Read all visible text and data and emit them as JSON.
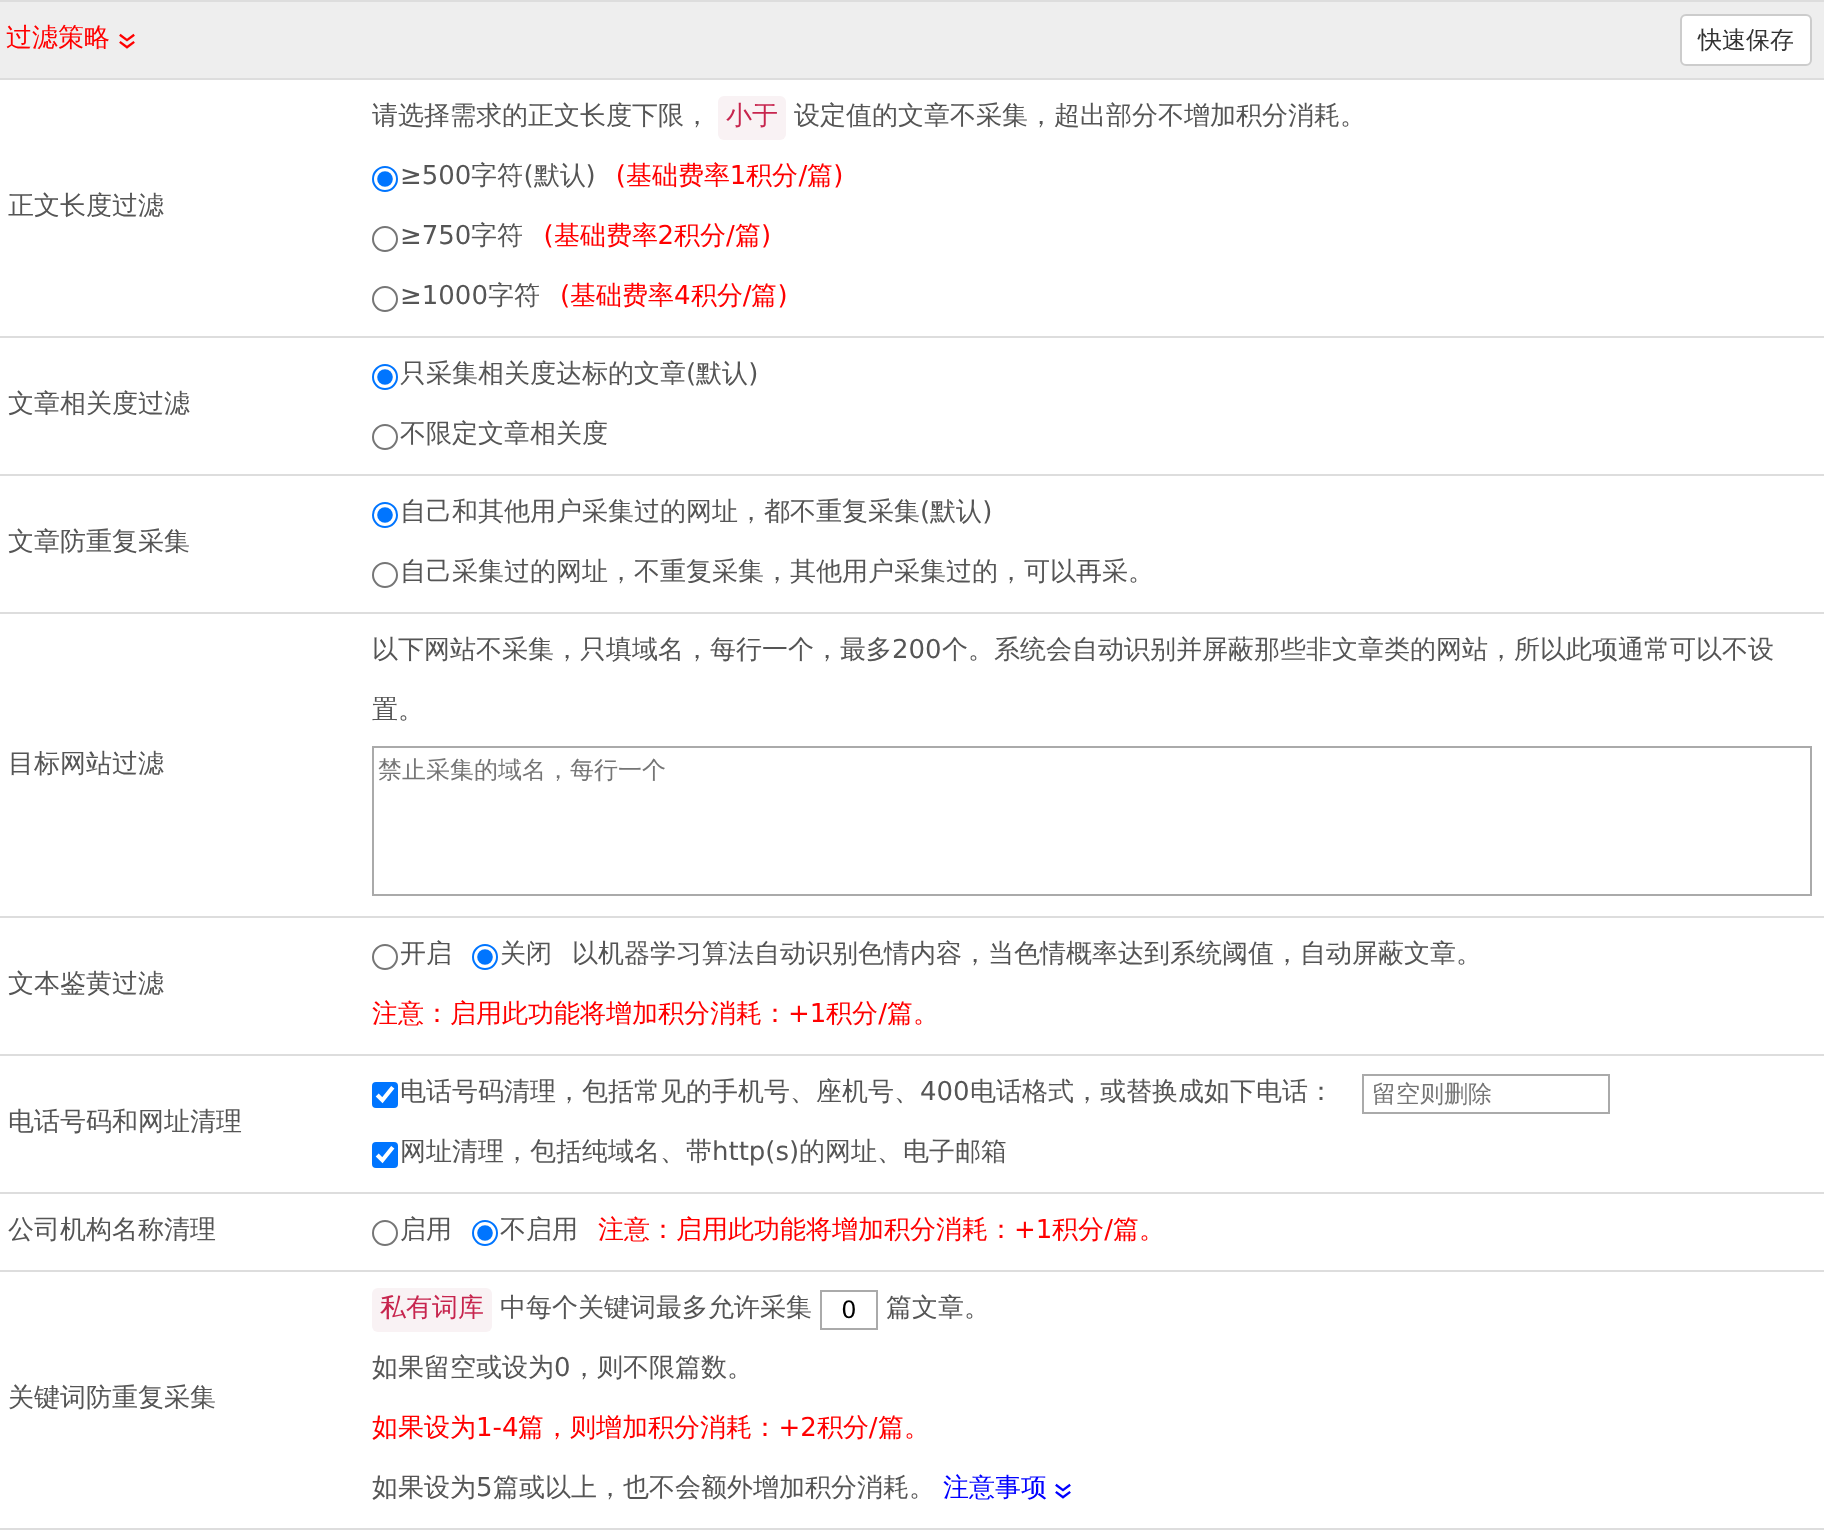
{
  "header": {
    "title": "过滤策略",
    "button": "快速保存"
  },
  "rows": [
    {
      "label": "正文长度过滤",
      "lines": [
        [
          {
            "kind": "text",
            "text": "请选择需求的正文长度下限，"
          },
          {
            "kind": "code",
            "text": "小于"
          },
          {
            "kind": "text",
            "text": "设定值的文章不采集，超出部分不增加积分消耗。"
          }
        ],
        [
          {
            "kind": "radio",
            "text": "≥500字符(默认)",
            "checked": true
          },
          {
            "kind": "note",
            "text": "(基础费率1积分/篇)"
          }
        ],
        [
          {
            "kind": "radio",
            "text": "≥750字符",
            "checked": false
          },
          {
            "kind": "note",
            "text": "(基础费率2积分/篇)"
          }
        ],
        [
          {
            "kind": "radio",
            "text": "≥1000字符",
            "checked": false
          },
          {
            "kind": "note",
            "text": "(基础费率4积分/篇)"
          }
        ]
      ]
    },
    {
      "label": "文章相关度过滤",
      "lines": [
        [
          {
            "kind": "radio",
            "text": "只采集相关度达标的文章(默认)",
            "checked": true
          }
        ],
        [
          {
            "kind": "radio",
            "text": "不限定文章相关度",
            "checked": false
          }
        ]
      ]
    },
    {
      "label": "文章防重复采集",
      "lines": [
        [
          {
            "kind": "radio",
            "text": "自己和其他用户采集过的网址，都不重复采集(默认)",
            "checked": true
          }
        ],
        [
          {
            "kind": "radio",
            "text": "自己采集过的网址，不重复采集，其他用户采集过的，可以再采。",
            "checked": false
          }
        ]
      ]
    },
    {
      "label": "目标网站过滤",
      "lines": [
        [
          {
            "kind": "text",
            "text": "以下网站不采集，只填域名，每行一个，最多200个。系统会自动识别并屏蔽那些非文章类的网站，所以此项通常可以不设置。"
          }
        ],
        [
          {
            "kind": "textarea",
            "placeholder": "禁止采集的域名，每行一个"
          }
        ]
      ]
    },
    {
      "label": "文本鉴黄过滤",
      "lines": [
        [
          {
            "kind": "radio",
            "text": "开启",
            "checked": false
          },
          {
            "kind": "radio",
            "text": "关闭",
            "checked": true
          },
          {
            "kind": "text",
            "text": "以机器学习算法自动识别色情内容，当色情概率达到系统阈值，自动屏蔽文章。"
          }
        ],
        [
          {
            "kind": "note",
            "text": "注意：启用此功能将增加积分消耗：+1积分/篇。"
          }
        ]
      ]
    },
    {
      "label": "电话号码和网址清理",
      "lines": [
        [
          {
            "kind": "checkbox",
            "text": "电话号码清理，包括常见的手机号、座机号、400电话格式，或替换成如下电话：",
            "checked": true
          },
          {
            "kind": "input",
            "placeholder": "留空则删除"
          }
        ],
        [
          {
            "kind": "checkbox",
            "text": "网址清理，包括纯域名、带http(s)的网址、电子邮箱",
            "checked": true
          }
        ]
      ]
    },
    {
      "label": "公司机构名称清理",
      "lines": [
        [
          {
            "kind": "radio",
            "text": "启用",
            "checked": false
          },
          {
            "kind": "radio",
            "text": "不启用",
            "checked": true
          },
          {
            "kind": "note",
            "text": "注意：启用此功能将增加积分消耗：+1积分/篇。"
          }
        ]
      ]
    },
    {
      "label": "关键词防重复采集",
      "lines": [
        [
          {
            "kind": "code",
            "text": "私有词库"
          },
          {
            "kind": "text",
            "text": "中每个关键词最多允许采集"
          },
          {
            "kind": "number",
            "value": "0"
          },
          {
            "kind": "text",
            "text": "篇文章。"
          }
        ],
        [
          {
            "kind": "text",
            "text": "如果留空或设为0，则不限篇数。"
          }
        ],
        [
          {
            "kind": "note",
            "text": "如果设为1-4篇，则增加积分消耗：+2积分/篇。"
          }
        ],
        [
          {
            "kind": "text",
            "text": "如果设为5篇或以上，也不会额外增加积分消耗。"
          },
          {
            "kind": "link",
            "text": "注意事项"
          }
        ]
      ]
    }
  ]
}
